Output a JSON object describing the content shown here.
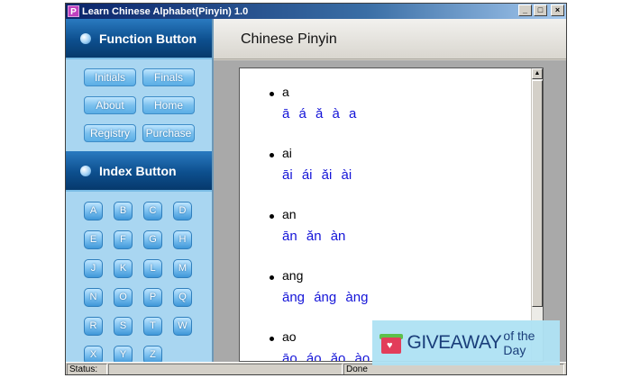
{
  "window": {
    "title": "Learn Chinese Alphabet(Pinyin) 1.0",
    "icon_glyph": "P",
    "controls": [
      "_",
      "□",
      "×"
    ]
  },
  "sidebar": {
    "function_header": "Function Button",
    "function_buttons": [
      "Initials",
      "Finals",
      "About",
      "Home",
      "Registry",
      "Purchase"
    ],
    "index_header": "Index Button",
    "index_buttons": [
      "A",
      "B",
      "C",
      "D",
      "E",
      "F",
      "G",
      "H",
      "J",
      "K",
      "L",
      "M",
      "N",
      "O",
      "P",
      "Q",
      "R",
      "S",
      "T",
      "W",
      "X",
      "Y",
      "Z"
    ]
  },
  "content": {
    "header": "Chinese Pinyin",
    "entries": [
      {
        "syllable": "a",
        "tones": "ā á ǎ à a"
      },
      {
        "syllable": "ai",
        "tones": "āi ái ǎi ài"
      },
      {
        "syllable": "an",
        "tones": "ān ǎn àn"
      },
      {
        "syllable": "ang",
        "tones": "āng áng àng"
      },
      {
        "syllable": "ao",
        "tones": "āo áo ǎo ào"
      }
    ]
  },
  "statusbar": {
    "label": "Status:",
    "done": "Done"
  },
  "watermark": {
    "main": "GIVEAWAY",
    "sub": "of the Day",
    "icon": "gift-box-icon"
  }
}
